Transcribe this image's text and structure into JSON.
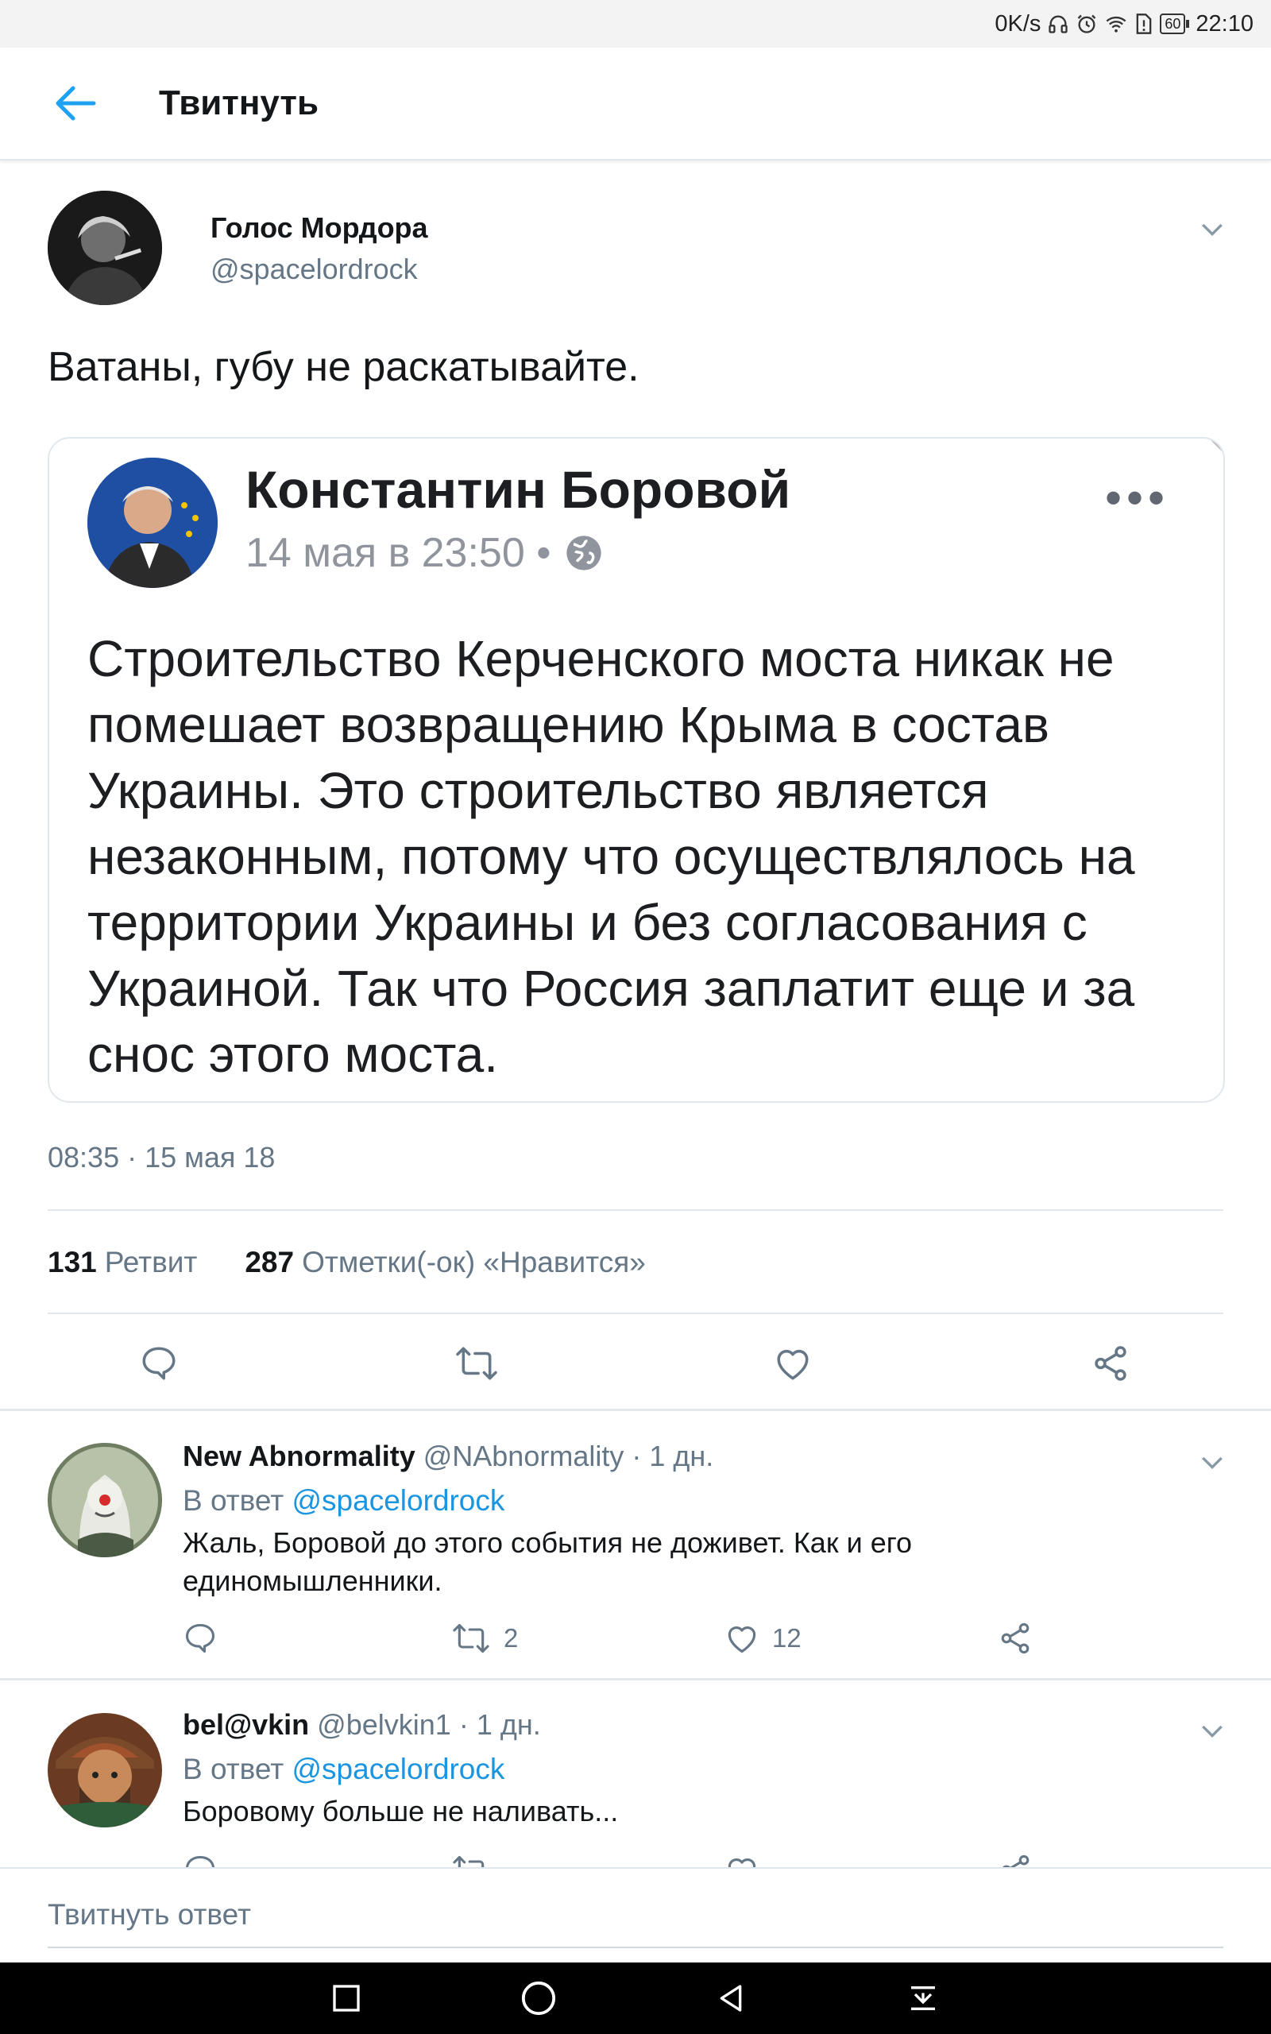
{
  "status_bar": {
    "speed": "0K/s",
    "battery": "60",
    "time": "22:10"
  },
  "app_bar": {
    "title": "Твитнуть"
  },
  "tweet": {
    "author_name": "Голос Мордора",
    "author_handle": "@spacelordrock",
    "text": "Ватаны, губу не раскатывайте.",
    "quoted_post": {
      "author": "Константин Боровой",
      "date": "14 мая в 23:50 •",
      "body": "Строительство Керченского моста никак не помешает возвращению Крыма в состав Украины. Это строительство является незаконным, потому что осуществлялось на территории Украины и без согласования с Украиной. Так что Россия заплатит еще и за снос этого моста."
    },
    "timestamp": "08:35 · 15 мая 18",
    "stats": {
      "retweets_count": "131",
      "retweets_label": "Ретвит",
      "likes_count": "287",
      "likes_label": "Отметки(-ок) «Нравится»"
    }
  },
  "replies": [
    {
      "name": "New Abnormality",
      "handle": "@NAbnormality",
      "time": "· 1 дн.",
      "reply_prefix": "В ответ",
      "reply_to": "@spacelordrock",
      "text": "Жаль, Боровой до этого события не доживет. Как и его единомышленники.",
      "retweets": "2",
      "likes": "12"
    },
    {
      "name": "bel@vkin",
      "handle": "@belvkin1",
      "time": "· 1 дн.",
      "reply_prefix": "В ответ",
      "reply_to": "@spacelordrock",
      "text": "Боровому больше не наливать..."
    }
  ],
  "compose": {
    "placeholder": "Твитнуть ответ"
  },
  "colors": {
    "accent": "#1da1f2",
    "link": "#1b95e0",
    "secondary_text": "#657786",
    "border": "#e1e8ed"
  }
}
